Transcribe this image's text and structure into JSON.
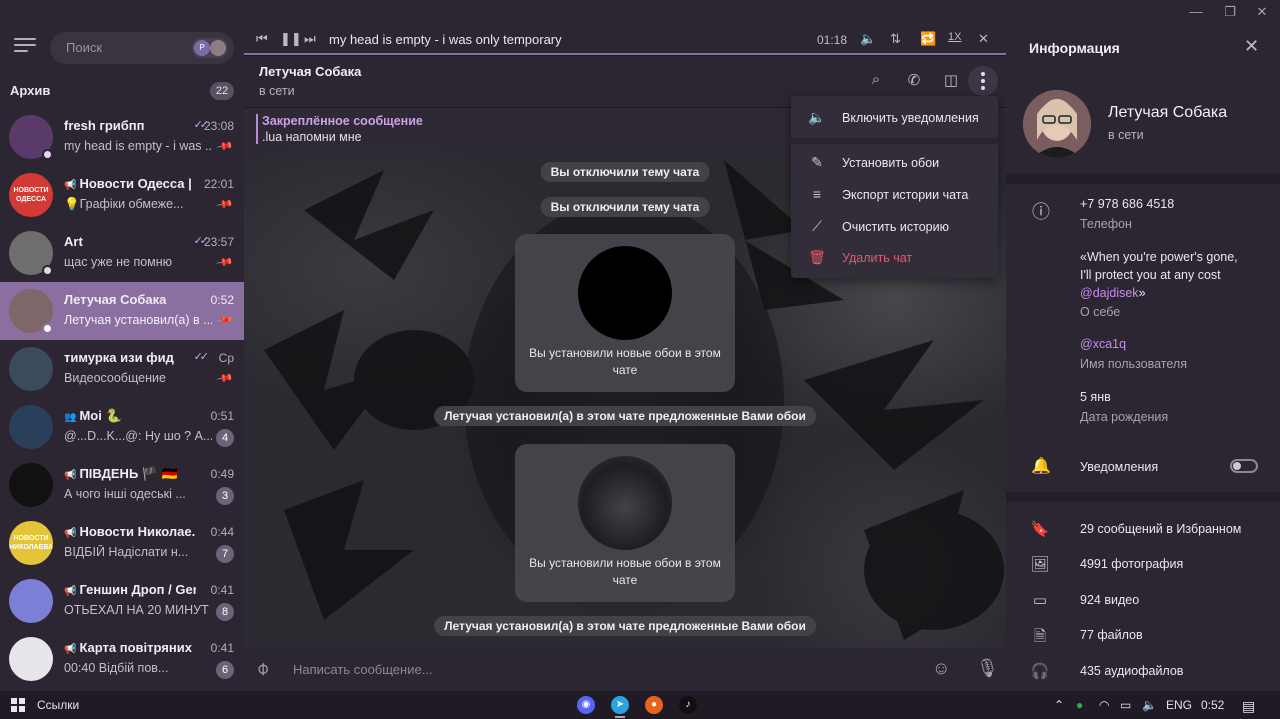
{
  "window": {
    "minimize": "—",
    "restore": "❐",
    "close": "✕"
  },
  "sidebar": {
    "search_placeholder": "Поиск",
    "search_chip_letter": "P",
    "archive": {
      "label": "Архив",
      "count": "22"
    },
    "chats": [
      {
        "name": "fresh грибпп",
        "time": "23:08",
        "check": "✓✓",
        "preview": "my head is empty - i was ...",
        "pinned": true,
        "online": true,
        "avatar_color": "#5a3a6a"
      },
      {
        "name": "Новости Одесса | ...",
        "time": "22:01",
        "channel": true,
        "preview": "💡Графіки обмеже...",
        "pinned": true,
        "avatar_color": "#d23a35",
        "avatar_text": "НОВОСТИ ОДЕССА"
      },
      {
        "name": "Art",
        "time": "23:57",
        "check": "✓✓",
        "preview": "щас уже не помню",
        "pinned": true,
        "online": true,
        "avatar_color": "#6e6e6e"
      },
      {
        "name": "Летучая Собака",
        "time": "0:52",
        "preview": "Летучая установил(а) в ...",
        "pinned": true,
        "online": true,
        "active": true,
        "avatar_color": "#7f6668"
      },
      {
        "name": "тимурка изи фид",
        "time": "Ср",
        "check": "✓✓",
        "preview": "Видеосообщение",
        "pinned": true,
        "avatar_color": "#3b4a5c"
      },
      {
        "name": "Моі 🐍",
        "time": "0:51",
        "group": true,
        "preview": "@...D...K...@: Ну шо ? А...",
        "badge": "4",
        "avatar_color": "#2a3f5a"
      },
      {
        "name": "ПІВДЕНЬ 🏴 🇩🇪",
        "time": "0:49",
        "channel": true,
        "preview": "А чого інші одеські ...",
        "badge": "3",
        "avatar_color": "#111111"
      },
      {
        "name": "Новости Николае...",
        "time": "0:44",
        "channel": true,
        "preview": "ВІДБІЙ  Надіслати н...",
        "badge": "7",
        "avatar_color": "#e5c43a",
        "avatar_text": "НОВОСТИ НИКОЛАЕВА"
      },
      {
        "name": "Геншин Дроп / Gen...",
        "time": "0:41",
        "channel": true,
        "preview": "ОТЬЕХАЛ НА 20 МИНУТ ...",
        "badge": "8",
        "avatar_color": "#7c7fd6"
      },
      {
        "name": "Карта повітряних ...",
        "time": "0:41",
        "channel": true,
        "preview": "00:40 Відбій пов...",
        "badge": "6",
        "avatar_color": "#e8e6ea"
      }
    ]
  },
  "player": {
    "title": "my head is empty - i was only temporary",
    "time": "01:18",
    "speed": "1X"
  },
  "chat": {
    "name": "Летучая Собака",
    "status": "в сети",
    "pinned_title": "Закреплённое сообщение",
    "pinned_text": ".lua напомни мне",
    "service_messages": [
      "Вы отключили тему чата",
      "Вы отключили тему чата"
    ],
    "wallpaper_text": "Вы установили новые обои в этом чате",
    "suggested_text": "Летучая установил(а) в этом чате предложенные Вами обои",
    "composer_placeholder": "Написать сообщение..."
  },
  "menu": {
    "items": [
      {
        "label": "Включить уведомления",
        "icon": "speaker-icon"
      },
      {
        "label": "Установить обои",
        "icon": "brush-icon"
      },
      {
        "label": "Экспорт истории чата",
        "icon": "export-icon"
      },
      {
        "label": "Очистить историю",
        "icon": "broom-icon"
      },
      {
        "label": "Удалить чат",
        "icon": "trash-icon",
        "danger": true
      }
    ]
  },
  "info": {
    "title": "Информация",
    "name": "Летучая Собака",
    "status": "в сети",
    "phone": "+7 978 686 4518",
    "phone_label": "Телефон",
    "bio_line1": "«When you're power's gone,",
    "bio_line2": "I'll protect you at any cost",
    "bio_link": "@dajdisek",
    "bio_tail": "»",
    "bio_label": "О себе",
    "username": "@xca1q",
    "username_label": "Имя пользователя",
    "birthday": "5 янв",
    "birthday_label": "Дата рождения",
    "notifications_label": "Уведомления",
    "notifications_on": false,
    "stats": [
      {
        "label": "29 сообщений в Избранном",
        "icon": "bookmark-icon"
      },
      {
        "label": "4991 фотография",
        "icon": "photo-icon"
      },
      {
        "label": "924 видео",
        "icon": "video-icon"
      },
      {
        "label": "77 файлов",
        "icon": "file-icon"
      },
      {
        "label": "435 аудиофайлов",
        "icon": "headphones-icon"
      }
    ]
  },
  "taskbar": {
    "links": "Ссылки",
    "lang": "ENG",
    "time": "0:52"
  },
  "colors": {
    "accent": "#8a6fa0",
    "link": "#c38fea",
    "danger": "#e35a68"
  }
}
